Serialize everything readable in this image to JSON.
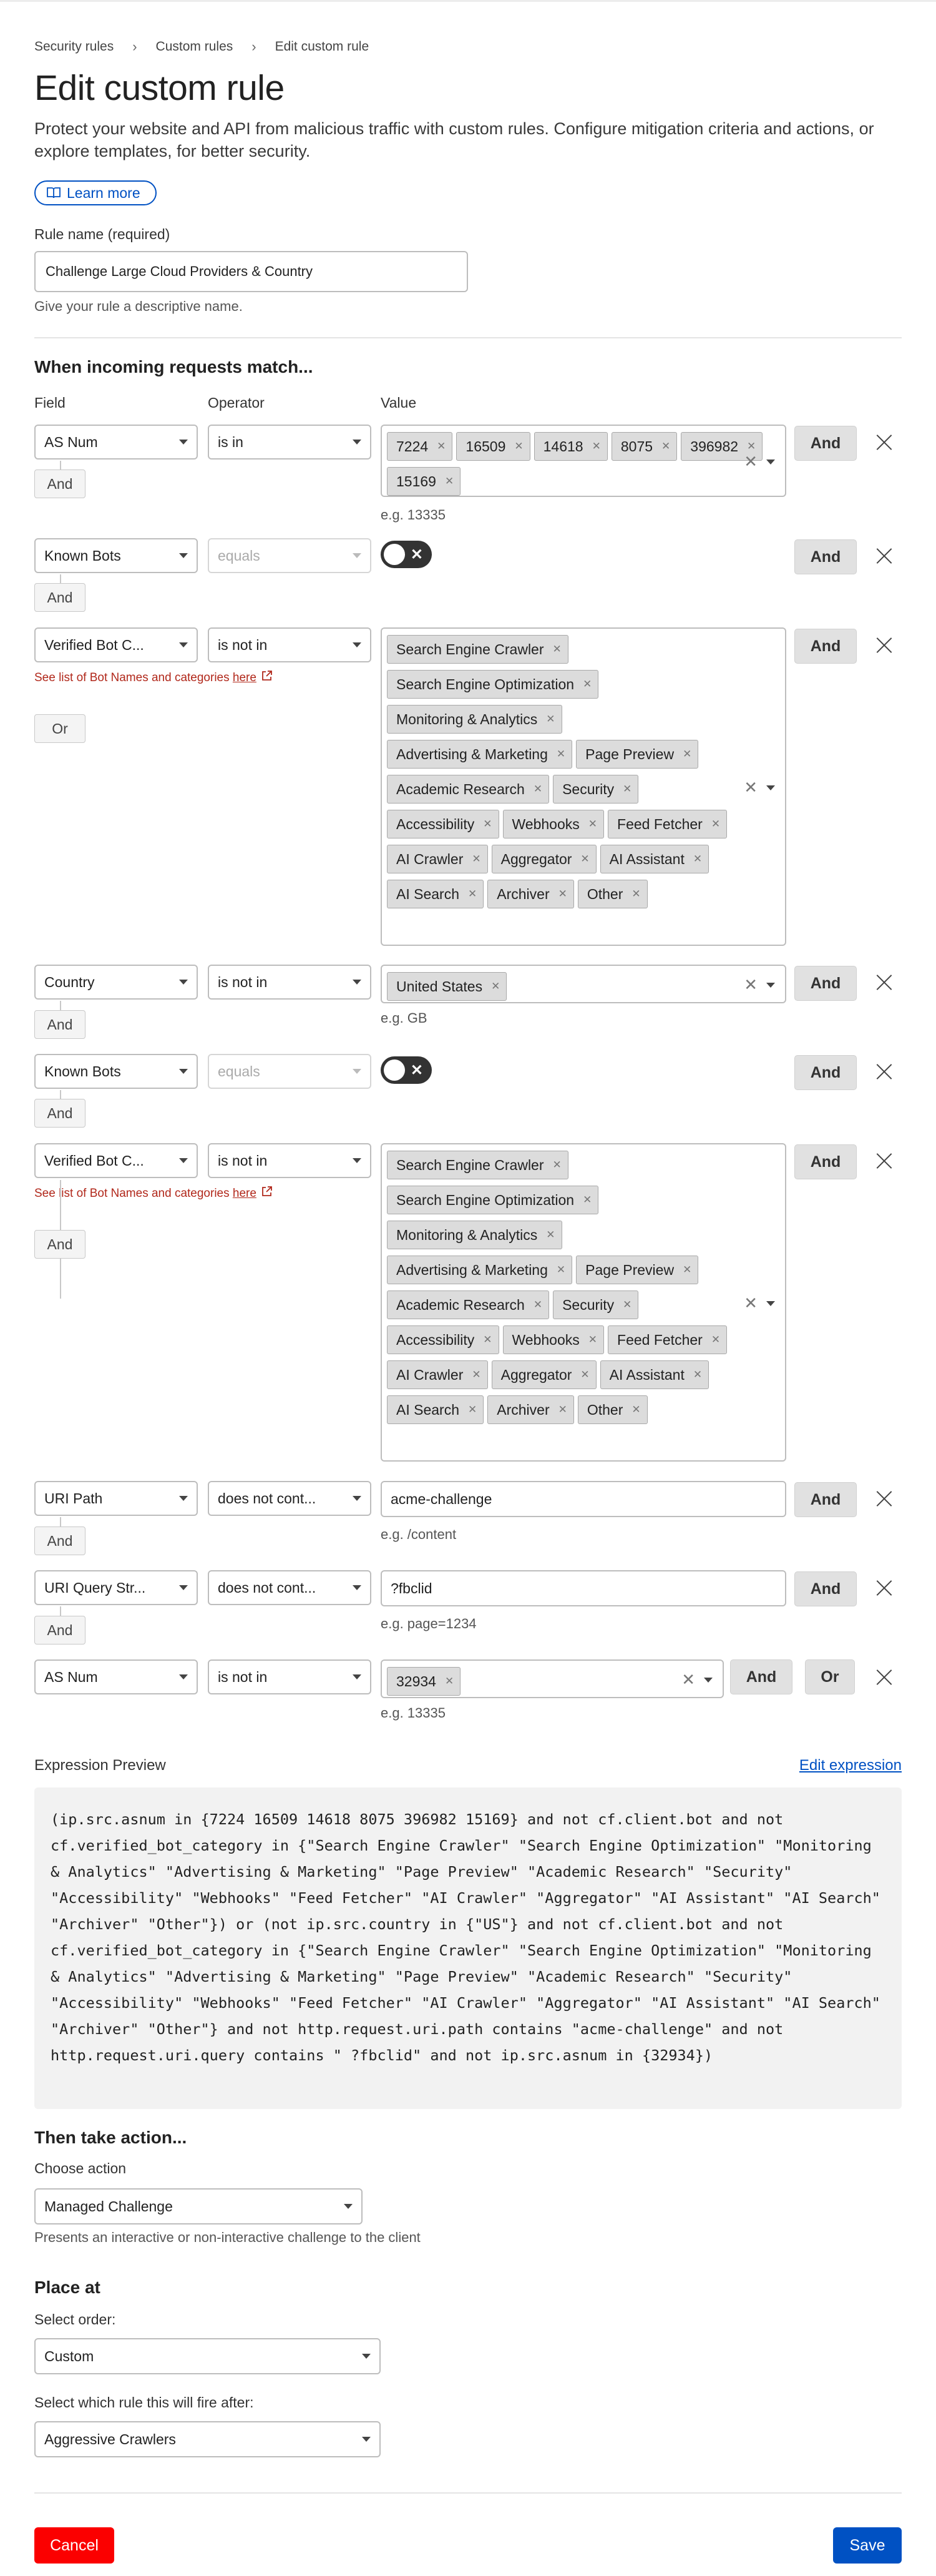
{
  "breadcrumb": [
    "Security rules",
    "Custom rules",
    "Edit custom rule"
  ],
  "title": "Edit custom rule",
  "description": "Protect your website and API from malicious traffic with custom rules. Configure mitigation criteria and actions, or explore templates, for better security.",
  "learn_more": "Learn more",
  "rule_name": {
    "label": "Rule name (required)",
    "value": "Challenge Large Cloud Providers & Country",
    "hint": "Give your rule a descriptive name."
  },
  "match": {
    "heading": "When incoming requests match...",
    "col_field": "Field",
    "col_operator": "Operator",
    "col_value": "Value",
    "and_label": "And",
    "or_label": "Or",
    "bot_link_text": "See list of Bot Names and categories ",
    "bot_link_here": "here",
    "rows": [
      {
        "field": "AS Num",
        "operator": "is in",
        "values": [
          "7224",
          "16509",
          "14618",
          "8075",
          "396982",
          "15169"
        ],
        "example": "e.g. 13335"
      },
      {
        "field": "Known Bots",
        "operator": "equals",
        "toggle": "✕"
      },
      {
        "field": "Verified Bot C...",
        "operator": "is not in",
        "values": [
          "Search Engine Crawler",
          "Search Engine Optimization",
          "Monitoring & Analytics",
          "Advertising & Marketing",
          "Page Preview",
          "Academic Research",
          "Security",
          "Accessibility",
          "Webhooks",
          "Feed Fetcher",
          "AI Crawler",
          "Aggregator",
          "AI Assistant",
          "AI Search",
          "Archiver",
          "Other"
        ]
      },
      {
        "field": "Country",
        "operator": "is not in",
        "values": [
          "United States"
        ],
        "example": "e.g. GB"
      },
      {
        "field": "Known Bots",
        "operator": "equals",
        "toggle": "✕"
      },
      {
        "field": "Verified Bot C...",
        "operator": "is not in",
        "values": [
          "Search Engine Crawler",
          "Search Engine Optimization",
          "Monitoring & Analytics",
          "Advertising & Marketing",
          "Page Preview",
          "Academic Research",
          "Security",
          "Accessibility",
          "Webhooks",
          "Feed Fetcher",
          "AI Crawler",
          "Aggregator",
          "AI Assistant",
          "AI Search",
          "Archiver",
          "Other"
        ]
      },
      {
        "field": "URI Path",
        "operator": "does not cont...",
        "value": "acme-challenge",
        "example": "e.g. /content"
      },
      {
        "field": "URI Query Str...",
        "operator": "does not cont...",
        "value": " ?fbclid",
        "example": "e.g. page=1234"
      },
      {
        "field": "AS Num",
        "operator": "is not in",
        "values": [
          "32934"
        ],
        "example": "e.g. 13335"
      }
    ]
  },
  "expression": {
    "label": "Expression Preview",
    "edit_link": "Edit expression",
    "text": "(ip.src.asnum in {7224 16509 14618 8075 396982 15169} and not cf.client.bot and not cf.verified_bot_category in {\"Search Engine Crawler\" \"Search Engine Optimization\" \"Monitoring & Analytics\" \"Advertising & Marketing\" \"Page Preview\" \"Academic Research\" \"Security\" \"Accessibility\" \"Webhooks\" \"Feed Fetcher\" \"AI Crawler\" \"Aggregator\" \"AI Assistant\" \"AI Search\" \"Archiver\" \"Other\"}) or (not ip.src.country in {\"US\"} and not cf.client.bot and not cf.verified_bot_category in {\"Search Engine Crawler\" \"Search Engine Optimization\" \"Monitoring & Analytics\" \"Advertising & Marketing\" \"Page Preview\" \"Academic Research\" \"Security\" \"Accessibility\" \"Webhooks\" \"Feed Fetcher\" \"AI Crawler\" \"Aggregator\" \"AI Assistant\" \"AI Search\" \"Archiver\" \"Other\"} and not http.request.uri.path contains \"acme-challenge\" and not http.request.uri.query contains \" ?fbclid\" and not ip.src.asnum in {32934})"
  },
  "action": {
    "heading": "Then take action...",
    "label": "Choose action",
    "value": "Managed Challenge",
    "hint": "Presents an interactive or non-interactive challenge to the client"
  },
  "place": {
    "heading": "Place at",
    "order_label": "Select order:",
    "order_value": "Custom",
    "after_label": "Select which rule this will fire after:",
    "after_value": "Aggressive Crawlers"
  },
  "footer": {
    "cancel": "Cancel",
    "save": "Save"
  },
  "colors": {
    "primary": "#0051c3",
    "danger": "#fb0000"
  }
}
